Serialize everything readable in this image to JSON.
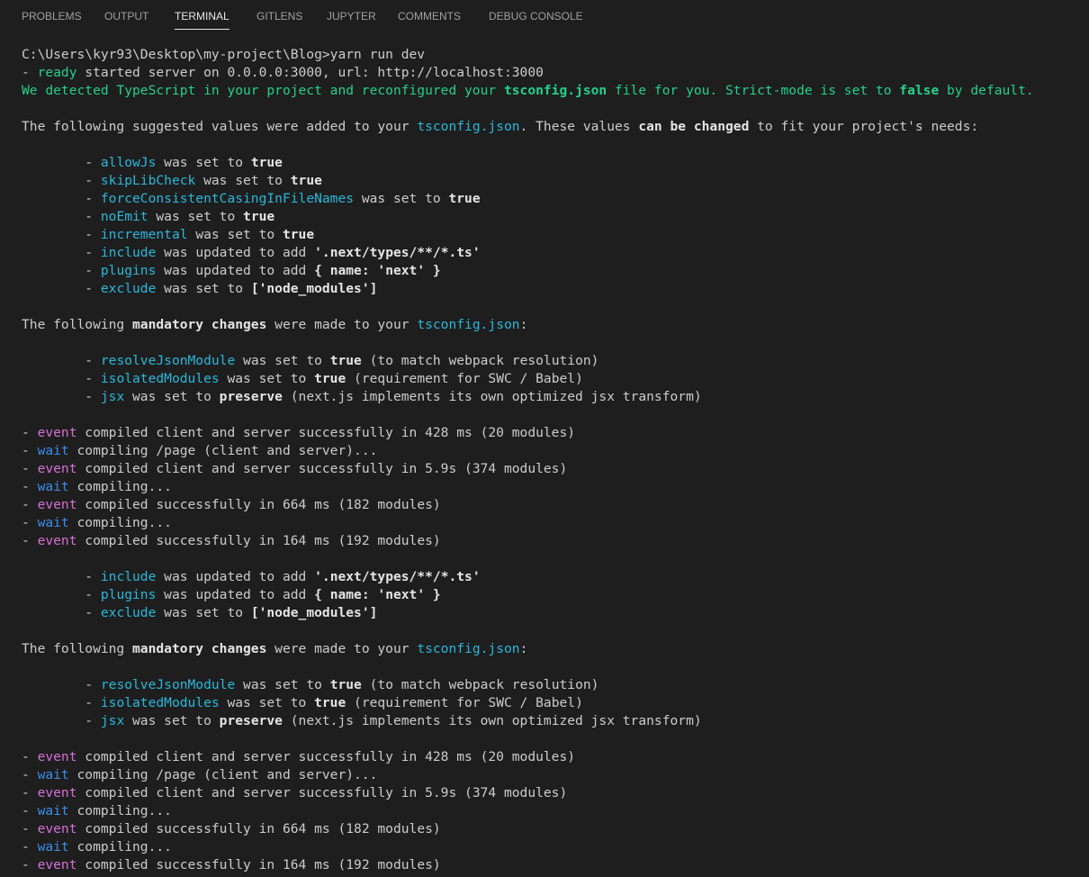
{
  "panel": {
    "tabs": [
      {
        "label": "PROBLEMS"
      },
      {
        "label": "OUTPUT"
      },
      {
        "label": "TERMINAL",
        "active": true
      },
      {
        "label": "GITLENS"
      },
      {
        "label": "JUPYTER"
      },
      {
        "label": "COMMENTS"
      },
      {
        "label": "DEBUG CONSOLE"
      }
    ]
  },
  "colors": {
    "background": "#1e1e1e",
    "default_text": "#cccccc",
    "key_cyan": "#29b8db",
    "ready_green": "#23d18b",
    "event_magenta": "#d670d6",
    "wait_blue": "#3b8eea"
  },
  "terminal": {
    "lines": [
      [
        [
          "C:\\Users\\kyr93\\Desktop\\my-project\\Blog>yarn run dev",
          "def"
        ]
      ],
      [
        [
          "- ",
          "def"
        ],
        [
          "ready",
          "green"
        ],
        [
          " started server on 0.0.0.0:3000, url: http://localhost:3000",
          "def"
        ]
      ],
      [
        [
          "We detected TypeScript in your project and reconfigured your ",
          "green"
        ],
        [
          "tsconfig.json",
          "bold-green"
        ],
        [
          " file for you. Strict-mode is set to ",
          "green"
        ],
        [
          "false",
          "bold-green"
        ],
        [
          " by default.",
          "green"
        ]
      ],
      [],
      [
        [
          "The following suggested values were added to your ",
          "def"
        ],
        [
          "tsconfig.json",
          "key"
        ],
        [
          ". These values ",
          "def"
        ],
        [
          "can be changed",
          "bold"
        ],
        [
          " to fit your project's needs:",
          "def"
        ]
      ],
      [],
      [
        [
          "        - ",
          "def"
        ],
        [
          "allowJs",
          "key"
        ],
        [
          " was set to ",
          "def"
        ],
        [
          "true",
          "bold"
        ]
      ],
      [
        [
          "        - ",
          "def"
        ],
        [
          "skipLibCheck",
          "key"
        ],
        [
          " was set to ",
          "def"
        ],
        [
          "true",
          "bold"
        ]
      ],
      [
        [
          "        - ",
          "def"
        ],
        [
          "forceConsistentCasingInFileNames",
          "key"
        ],
        [
          " was set to ",
          "def"
        ],
        [
          "true",
          "bold"
        ]
      ],
      [
        [
          "        - ",
          "def"
        ],
        [
          "noEmit",
          "key"
        ],
        [
          " was set to ",
          "def"
        ],
        [
          "true",
          "bold"
        ]
      ],
      [
        [
          "        - ",
          "def"
        ],
        [
          "incremental",
          "key"
        ],
        [
          " was set to ",
          "def"
        ],
        [
          "true",
          "bold"
        ]
      ],
      [
        [
          "        - ",
          "def"
        ],
        [
          "include",
          "key"
        ],
        [
          " was updated to add ",
          "def"
        ],
        [
          "'.next/types/**/*.ts'",
          "bold"
        ]
      ],
      [
        [
          "        - ",
          "def"
        ],
        [
          "plugins",
          "key"
        ],
        [
          " was updated to add ",
          "def"
        ],
        [
          "{ name: 'next' }",
          "bold"
        ]
      ],
      [
        [
          "        - ",
          "def"
        ],
        [
          "exclude",
          "key"
        ],
        [
          " was set to ",
          "def"
        ],
        [
          "['node_modules']",
          "bold"
        ]
      ],
      [],
      [
        [
          "The following ",
          "def"
        ],
        [
          "mandatory changes",
          "bold"
        ],
        [
          " were made to your ",
          "def"
        ],
        [
          "tsconfig.json",
          "key"
        ],
        [
          ":",
          "def"
        ]
      ],
      [],
      [
        [
          "        - ",
          "def"
        ],
        [
          "resolveJsonModule",
          "key"
        ],
        [
          " was set to ",
          "def"
        ],
        [
          "true",
          "bold"
        ],
        [
          " (to match webpack resolution)",
          "def"
        ]
      ],
      [
        [
          "        - ",
          "def"
        ],
        [
          "isolatedModules",
          "key"
        ],
        [
          " was set to ",
          "def"
        ],
        [
          "true",
          "bold"
        ],
        [
          " (requirement for SWC / Babel)",
          "def"
        ]
      ],
      [
        [
          "        - ",
          "def"
        ],
        [
          "jsx",
          "key"
        ],
        [
          " was set to ",
          "def"
        ],
        [
          "preserve",
          "bold"
        ],
        [
          " (next.js implements its own optimized jsx transform)",
          "def"
        ]
      ],
      [],
      [
        [
          "- ",
          "def"
        ],
        [
          "event",
          "magenta"
        ],
        [
          " compiled client and server successfully in 428 ms (20 modules)",
          "def"
        ]
      ],
      [
        [
          "- ",
          "def"
        ],
        [
          "wait",
          "blue"
        ],
        [
          " compiling /page (client and server)...",
          "def"
        ]
      ],
      [
        [
          "- ",
          "def"
        ],
        [
          "event",
          "magenta"
        ],
        [
          " compiled client and server successfully in 5.9s (374 modules)",
          "def"
        ]
      ],
      [
        [
          "- ",
          "def"
        ],
        [
          "wait",
          "blue"
        ],
        [
          " compiling...",
          "def"
        ]
      ],
      [
        [
          "- ",
          "def"
        ],
        [
          "event",
          "magenta"
        ],
        [
          " compiled successfully in 664 ms (182 modules)",
          "def"
        ]
      ],
      [
        [
          "- ",
          "def"
        ],
        [
          "wait",
          "blue"
        ],
        [
          " compiling...",
          "def"
        ]
      ],
      [
        [
          "- ",
          "def"
        ],
        [
          "event",
          "magenta"
        ],
        [
          " compiled successfully in 164 ms (192 modules)",
          "def"
        ]
      ],
      [],
      [
        [
          "        - ",
          "def"
        ],
        [
          "include",
          "key"
        ],
        [
          " was updated to add ",
          "def"
        ],
        [
          "'.next/types/**/*.ts'",
          "bold"
        ]
      ],
      [
        [
          "        - ",
          "def"
        ],
        [
          "plugins",
          "key"
        ],
        [
          " was updated to add ",
          "def"
        ],
        [
          "{ name: 'next' }",
          "bold"
        ]
      ],
      [
        [
          "        - ",
          "def"
        ],
        [
          "exclude",
          "key"
        ],
        [
          " was set to ",
          "def"
        ],
        [
          "['node_modules']",
          "bold"
        ]
      ],
      [],
      [
        [
          "The following ",
          "def"
        ],
        [
          "mandatory changes",
          "bold"
        ],
        [
          " were made to your ",
          "def"
        ],
        [
          "tsconfig.json",
          "key"
        ],
        [
          ":",
          "def"
        ]
      ],
      [],
      [
        [
          "        - ",
          "def"
        ],
        [
          "resolveJsonModule",
          "key"
        ],
        [
          " was set to ",
          "def"
        ],
        [
          "true",
          "bold"
        ],
        [
          " (to match webpack resolution)",
          "def"
        ]
      ],
      [
        [
          "        - ",
          "def"
        ],
        [
          "isolatedModules",
          "key"
        ],
        [
          " was set to ",
          "def"
        ],
        [
          "true",
          "bold"
        ],
        [
          " (requirement for SWC / Babel)",
          "def"
        ]
      ],
      [
        [
          "        - ",
          "def"
        ],
        [
          "jsx",
          "key"
        ],
        [
          " was set to ",
          "def"
        ],
        [
          "preserve",
          "bold"
        ],
        [
          " (next.js implements its own optimized jsx transform)",
          "def"
        ]
      ],
      [],
      [
        [
          "- ",
          "def"
        ],
        [
          "event",
          "magenta"
        ],
        [
          " compiled client and server successfully in 428 ms (20 modules)",
          "def"
        ]
      ],
      [
        [
          "- ",
          "def"
        ],
        [
          "wait",
          "blue"
        ],
        [
          " compiling /page (client and server)...",
          "def"
        ]
      ],
      [
        [
          "- ",
          "def"
        ],
        [
          "event",
          "magenta"
        ],
        [
          " compiled client and server successfully in 5.9s (374 modules)",
          "def"
        ]
      ],
      [
        [
          "- ",
          "def"
        ],
        [
          "wait",
          "blue"
        ],
        [
          " compiling...",
          "def"
        ]
      ],
      [
        [
          "- ",
          "def"
        ],
        [
          "event",
          "magenta"
        ],
        [
          " compiled successfully in 664 ms (182 modules)",
          "def"
        ]
      ],
      [
        [
          "- ",
          "def"
        ],
        [
          "wait",
          "blue"
        ],
        [
          " compiling...",
          "def"
        ]
      ],
      [
        [
          "- ",
          "def"
        ],
        [
          "event",
          "magenta"
        ],
        [
          " compiled successfully in 164 ms (192 modules)",
          "def"
        ]
      ]
    ]
  }
}
